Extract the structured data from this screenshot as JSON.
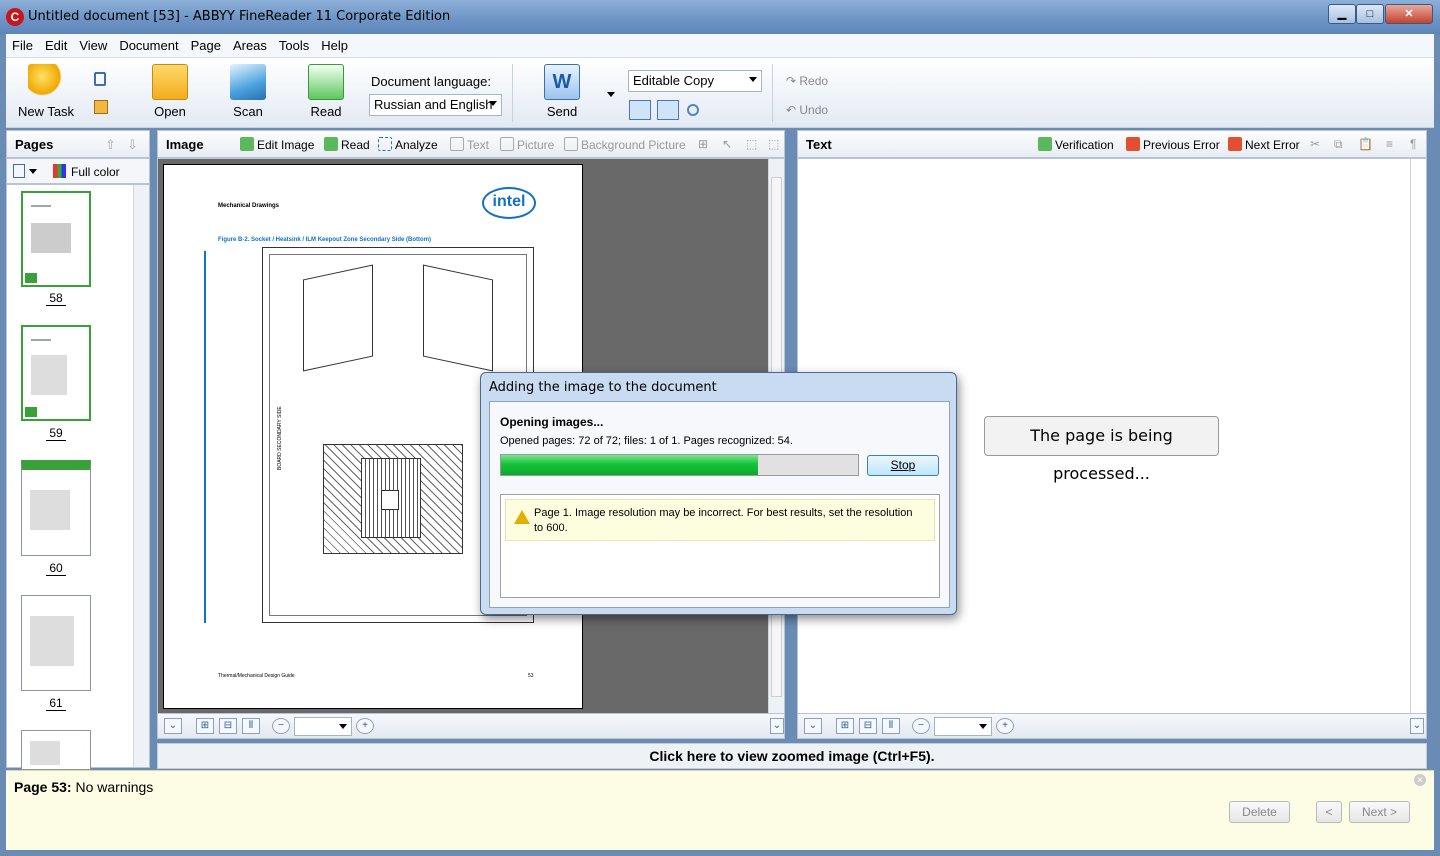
{
  "window": {
    "title": "Untitled document [53] - ABBYY FineReader 11 Corporate Edition",
    "minimize": "▁",
    "maximize": "□",
    "close": "✕"
  },
  "menu": [
    "File",
    "Edit",
    "View",
    "Document",
    "Page",
    "Areas",
    "Tools",
    "Help"
  ],
  "toolbar": {
    "new_task": "New Task",
    "open": "Open",
    "scan": "Scan",
    "read": "Read",
    "language_label": "Document language:",
    "language_value": "Russian and English",
    "send": "Send",
    "format_value": "Editable Copy",
    "redo": "Redo",
    "undo": "Undo"
  },
  "pages_pane": {
    "title": "Pages",
    "color_mode": "Full color",
    "page_numbers": [
      "58",
      "59",
      "60",
      "61"
    ]
  },
  "image_pane": {
    "title": "Image",
    "edit_image": "Edit Image",
    "read": "Read",
    "analyze": "Analyze",
    "text": "Text",
    "picture": "Picture",
    "background_picture": "Background Picture"
  },
  "text_pane": {
    "title": "Text",
    "verification": "Verification",
    "previous_error": "Previous Error",
    "next_error": "Next Error",
    "processing_message": "The page is being processed..."
  },
  "doc_page": {
    "header": "Mechanical Drawings",
    "figure_caption": "Figure B-2.   Socket / Heatsink / ILM Keepout Zone Secondary Side (Bottom)",
    "logo": "intel",
    "footer_left": "Thermal/Mechanical Design Guide",
    "footer_right": "53",
    "side_label": "BOARD SECONDARY SIDE"
  },
  "zoom_link": "Click here to view zoomed image (Ctrl+F5).",
  "status": {
    "page_label": "Page 53:",
    "message": "No warnings",
    "delete": "Delete",
    "prev": "<",
    "next": "Next >"
  },
  "dialog": {
    "title": "Adding the image to the document",
    "heading": "Opening images...",
    "detail": "Opened pages: 72 of 72; files: 1 of 1. Pages recognized: 54.",
    "progress": 0.72,
    "stop": "Stop",
    "warning": "Page 1. Image resolution may be incorrect. For best results, set the resolution to 600."
  }
}
